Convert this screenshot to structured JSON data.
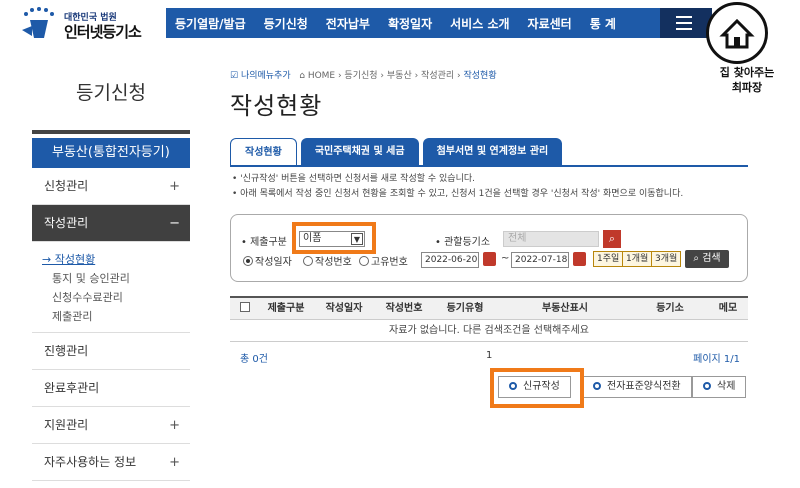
{
  "header": {
    "court_name": "대한민국 법원",
    "site_name": "인터넷등기소",
    "nav": [
      "등기열람/발급",
      "등기신청",
      "전자납부",
      "확정일자",
      "서비스 소개",
      "자료센터",
      "통 계"
    ]
  },
  "watermark": {
    "line1": "집 찾아주는",
    "line2": "최파장"
  },
  "sidebar": {
    "title": "등기신청",
    "section": "부동산(통합전자등기)",
    "items": [
      {
        "label": "신청관리",
        "icon": "+"
      },
      {
        "label": "작성관리",
        "icon": "−"
      },
      {
        "label": "진행관리",
        "icon": ""
      },
      {
        "label": "완료후관리",
        "icon": ""
      },
      {
        "label": "지원관리",
        "icon": "+"
      },
      {
        "label": "자주사용하는 정보",
        "icon": "+"
      }
    ],
    "subitems": [
      "→ 작성현황",
      "통지 및 승인관리",
      "신청수수료관리",
      "제출관리"
    ]
  },
  "breadcrumb": {
    "my_menu": "나의메뉴추가",
    "path": "HOME › 등기신청 › 부동산 › 작성관리 › ",
    "current": "작성현황"
  },
  "page_title": "작성현황",
  "tabs": [
    "작성현황",
    "국민주택채권 및 세금",
    "첨부서면 및 연계정보 관리"
  ],
  "notices": [
    "• '신규작성' 버튼을 선택하면 신청서를 새로 작성할 수 있습니다.",
    "• 아래 목록에서 작성 중인 신청서 현황을 조회할 수 있고, 신청서 1건을 선택할 경우 '신청서 작성' 화면으로 이동합니다."
  ],
  "search": {
    "submit_type_label": "• 제출구분",
    "submit_type_value": "이폼",
    "court_label": "• 관할등기소",
    "court_placeholder": "전체",
    "radio_options": [
      "작성일자",
      "작성번호",
      "고유번호"
    ],
    "date_from": "2022-06-20",
    "date_to": "2022-07-18",
    "tilde": "~",
    "periods": [
      "1주일",
      "1개월",
      "3개월"
    ],
    "search_button": "검색"
  },
  "table": {
    "columns": [
      "제출구분",
      "작성일자",
      "작성번호",
      "등기유형",
      "부동산표시",
      "등기소",
      "메모"
    ],
    "empty_message": "자료가 없습니다. 다른 검색조건을 선택해주세요"
  },
  "pagination": {
    "total": "총 0건",
    "page": "1",
    "page_info": "페이지 1/1"
  },
  "actions": {
    "new": "신규작성",
    "convert": "전자표준양식전환",
    "delete": "삭제"
  },
  "colors": {
    "primary": "#1e5aa8",
    "highlight": "#f07a19",
    "active_menu": "#404040"
  }
}
